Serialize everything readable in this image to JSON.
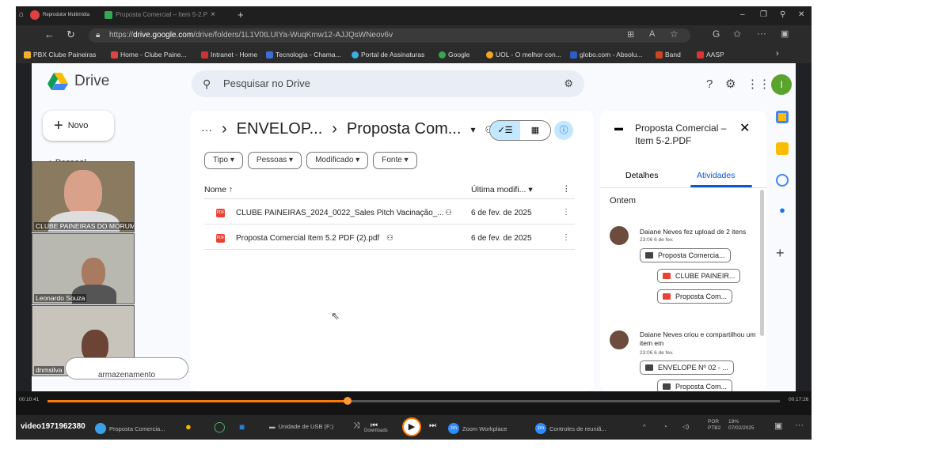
{
  "titlebar": {
    "app_name": "Reprodutor Multimídia",
    "tab_title": "Proposta Comercial – Item 5-2.P",
    "close_x": "×",
    "new_tab": "+"
  },
  "browser": {
    "url_prefix": "https://",
    "url_domain": "drive.google.com",
    "url_path": "/drive/folders/1L1V0tLUIYa-WuqKmw12-AJJQsWNeov6v"
  },
  "bookmarks": [
    {
      "label": "PBX Clube Paineiras",
      "color": "#f2b02c"
    },
    {
      "label": "Home - Clube Paine...",
      "color": "#d44"
    },
    {
      "label": "Intranet - Home",
      "color": "#c33"
    },
    {
      "label": "Tecnologia - Chama...",
      "color": "#3a6fd8"
    },
    {
      "label": "Portal de Assinaturas",
      "color": "#3cb0e0"
    },
    {
      "label": "Google",
      "color": "#34a853"
    },
    {
      "label": "UOL - O melhor con...",
      "color": "#f5a623"
    },
    {
      "label": "globo.com - Absolu...",
      "color": "#2b5ec9"
    },
    {
      "label": "Band",
      "color": "#c42"
    },
    {
      "label": "AASP",
      "color": "#d33"
    }
  ],
  "drive": {
    "logo_text": "Drive",
    "search_placeholder": "Pesquisar no Drive",
    "avatar_letter": "I",
    "new_button": "Novo",
    "new_plus": "+",
    "nav_personal": "Pessoal",
    "storage_label": "armazenamento"
  },
  "breadcrumb": {
    "ellipsis": "···",
    "sep": "›",
    "folder1": "ENVELOP...",
    "folder2": "Proposta Com...",
    "caret": "▾"
  },
  "view_toggle": {
    "list": "✓☰",
    "grid": "▦",
    "info": "ⓘ"
  },
  "filters": [
    "Tipo",
    "Pessoas",
    "Modificado",
    "Fonte"
  ],
  "table": {
    "col_name": "Nome",
    "sort_arrow": "↑",
    "col_modified": "Última modifi...",
    "rows": [
      {
        "name": "CLUBE PAINEIRAS_2024_0022_Sales Pitch Vacinação_...",
        "modified": "6 de fev. de 2025"
      },
      {
        "name": "Proposta Comercial Item 5.2 PDF (2).pdf",
        "modified": "6 de fev. de 2025"
      }
    ]
  },
  "panel": {
    "title": "Proposta Comercial – Item 5-2.PDF",
    "close": "✕",
    "tab_details": "Detalhes",
    "tab_activity": "Atividades",
    "section": "Ontem",
    "activity1": {
      "text": "Daiane Neves fez upload de 2 itens",
      "time": "23:06 6 de fev.",
      "folder": "Proposta Comercia...",
      "file1": "CLUBE PAINEIR...",
      "file2": "Proposta Com..."
    },
    "activity2": {
      "text": "Daiane Neves criou e compartilhou um item em",
      "time": "23:06 6 de fev.",
      "folder": "ENVELOPE Nº 02 - ...",
      "file": "Proposta Com..."
    }
  },
  "participants": [
    {
      "name": "CLUBE PAINEIRAS DO MORUMBY"
    },
    {
      "name": "Leonardo Souza"
    },
    {
      "name": "dnmsilva"
    }
  ],
  "player": {
    "time_start": "00:10:41",
    "time_end": "00:17:26",
    "progress": 0.41
  },
  "taskbar": {
    "video_name": "video1971962380",
    "item1": "Proposta Comercia...",
    "item2": "Unidade de USB (F:)",
    "item3": "Downloads",
    "item4": "Zoom Workplace",
    "item5": "Controles de reuniã...",
    "lang1": "POR",
    "lang2": "PTB2",
    "date": "07/02/2025",
    "battery": "19%"
  }
}
